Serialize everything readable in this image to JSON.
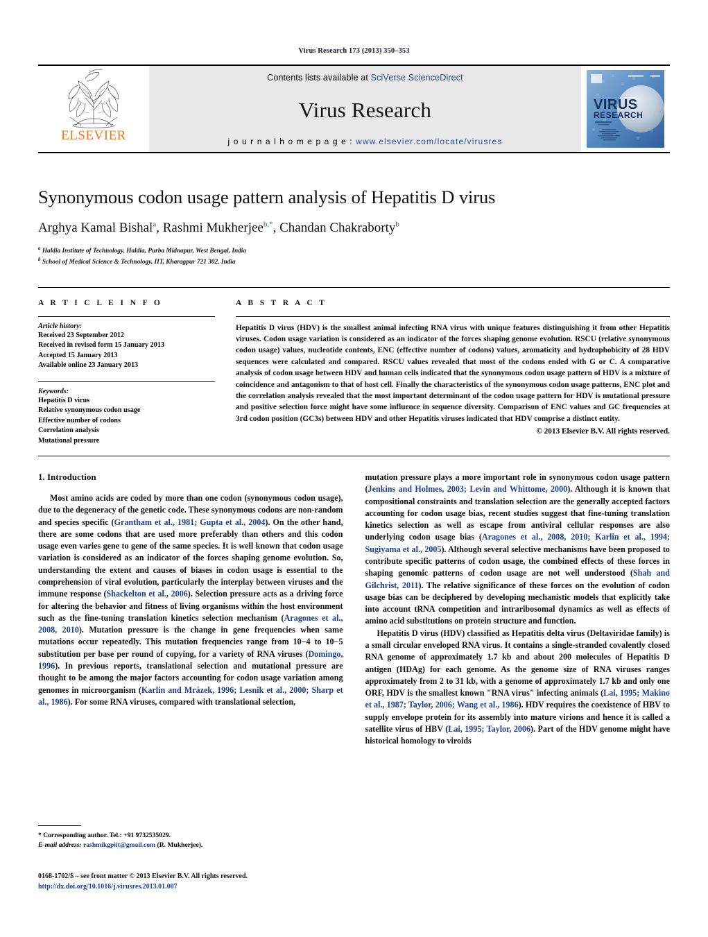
{
  "running_head": "Virus Research 173 (2013) 350–353",
  "masthead": {
    "contents_prefix": "Contents lists available at ",
    "contents_link": "SciVerse ScienceDirect",
    "journal_title": "Virus Research",
    "homepage_prefix": "j o u r n a l   h o m e p a g e :  ",
    "homepage_url": "www.elsevier.com/locate/virusres",
    "publisher_word": "ELSEVIER",
    "cover_title_line1": "VIRUS",
    "cover_title_line2": "RESEARCH"
  },
  "title": "Synonymous codon usage pattern analysis of Hepatitis D virus",
  "authors": [
    {
      "name": "Arghya Kamal Bishal",
      "marks": "a"
    },
    {
      "name": "Rashmi Mukherjee",
      "marks": "b,*"
    },
    {
      "name": "Chandan Chakraborty",
      "marks": "b"
    }
  ],
  "affiliations": [
    {
      "mark": "a",
      "text": "Haldia Institute of Technology, Haldia, Purba Midnapur, West Bengal, India"
    },
    {
      "mark": "b",
      "text": "School of Medical Science & Technology, IIT, Kharagpur 721 302, India"
    }
  ],
  "article_info": {
    "heading": "A R T I C L E   I N F O",
    "history_label": "Article history:",
    "history": [
      "Received 23 September 2012",
      "Received in revised form 15 January 2013",
      "Accepted 15 January 2013",
      "Available online 23 January 2013"
    ],
    "keywords_label": "Keywords:",
    "keywords": [
      "Hepatitis D virus",
      "Relative synonymous codon usage",
      "Effective number of codons",
      "Correlation analysis",
      "Mutational pressure"
    ]
  },
  "abstract": {
    "heading": "A B S T R A C T",
    "text": "Hepatitis D virus (HDV) is the smallest animal infecting RNA virus with unique features distinguishing it from other Hepatitis viruses. Codon usage variation is considered as an indicator of the forces shaping genome evolution. RSCU (relative synonymous codon usage) values, nucleotide contents, ENC (effective number of codons) values, aromaticity and hydrophobicity of 28 HDV sequences were calculated and compared. RSCU values revealed that most of the codons ended with G or C. A comparative analysis of codon usage between HDV and human cells indicated that the synonymous codon usage pattern of HDV is a mixture of coincidence and antagonism to that of host cell. Finally the characteristics of the synonymous codon usage patterns, ENC plot and the correlation analysis revealed that the most important determinant of the codon usage pattern for HDV is mutational pressure and positive selection force might have some influence in sequence diversity. Comparison of ENC values and GC frequencies at 3rd codon position (GC3s) between HDV and other Hepatitis viruses indicated that HDV comprise a distinct entity.",
    "copyright": "© 2013 Elsevier B.V. All rights reserved."
  },
  "body": {
    "section_number_title": "1. Introduction",
    "left_paragraphs": [
      "Most amino acids are coded by more than one codon (synonymous codon usage), due to the degeneracy of the genetic code. These synonymous codons are non-random and species specific (Grantham et al., 1981; Gupta et al., 2004). On the other hand, there are some codons that are used more preferably than others and this codon usage even varies gene to gene of the same species. It is well known that codon usage variation is considered as an indicator of the forces shaping genome evolution. So, understanding the extent and causes of biases in codon usage is essential to the comprehension of viral evolution, particularly the interplay between viruses and the immune response (Shackelton et al., 2006). Selection pressure acts as a driving force for altering the behavior and fitness of living organisms within the host environment such as the fine-tuning translation kinetics selection mechanism (Aragones et al., 2008, 2010). Mutation pressure is the change in gene frequencies when same mutations occur repeatedly. This mutation frequencies range from 10−4 to 10−5 substitution per base per round of copying, for a variety of RNA viruses (Domingo, 1996). In previous reports, translational selection and mutational pressure are thought to be among the major factors accounting for codon usage variation among genomes in microorganism (Karlin and Mrázek, 1996; Lesnik et al., 2000; Sharp et al., 1986). For some RNA viruses, compared with translational selection,"
    ],
    "right_paragraphs": [
      "mutation pressure plays a more important role in synonymous codon usage pattern (Jenkins and Holmes, 2003; Levin and Whittome, 2000). Although it is known that compositional constraints and translation selection are the generally accepted factors accounting for codon usage bias, recent studies suggest that fine-tuning translation kinetics selection as well as escape from antiviral cellular responses are also underlying codon usage bias (Aragones et al., 2008, 2010; Karlin et al., 1994; Sugiyama et al., 2005). Although several selective mechanisms have been proposed to contribute specific patterns of codon usage, the combined effects of these forces in shaping genomic patterns of codon usage are not well understood (Shah and Gilchrist, 2011). The relative significance of these forces on the evolution of codon usage bias can be deciphered by developing mechanistic models that explicitly take into account tRNA competition and intraribosomal dynamics as well as effects of amino acid substitutions on protein structure and function.",
      "Hepatitis D virus (HDV) classified as Hepatitis delta virus (Deltaviridae family) is a small circular enveloped RNA virus. It contains a single-stranded covalently closed RNA genome of approximately 1.7 kb and about 200 molecules of Hepatitis D antigen (HDAg) for each genome. As the genome size of RNA viruses ranges approximately from 2 to 31 kb, with a genome of approximately 1.7 kb and only one ORF, HDV is the smallest known \"RNA virus\" infecting animals (Lai, 1995; Makino et al., 1987; Taylor, 2006; Wang et al., 1986). HDV requires the coexistence of HBV to supply envelope protein for its assembly into mature virions and hence it is called a satellite virus of HBV (Lai, 1995; Taylor, 2006). Part of the HDV genome might have historical homology to viroids"
    ]
  },
  "footnote": {
    "corresponding": "* Corresponding author. Tel.: +91 9732535029.",
    "email_label": "E-mail address:",
    "email": "rashmikgpiit@gmail.com",
    "email_suffix": " (R. Mukherjee)."
  },
  "imprint": {
    "line1": "0168-1702/$ – see front matter © 2013 Elsevier B.V. All rights reserved.",
    "line2": "http://dx.doi.org/10.1016/j.virusres.2013.01.007"
  },
  "colors": {
    "link_blue": "#1b3f8f",
    "header_navy": "#18184a",
    "elsevier_orange": "#E87722",
    "masthead_grey": "#e9e9e9"
  }
}
